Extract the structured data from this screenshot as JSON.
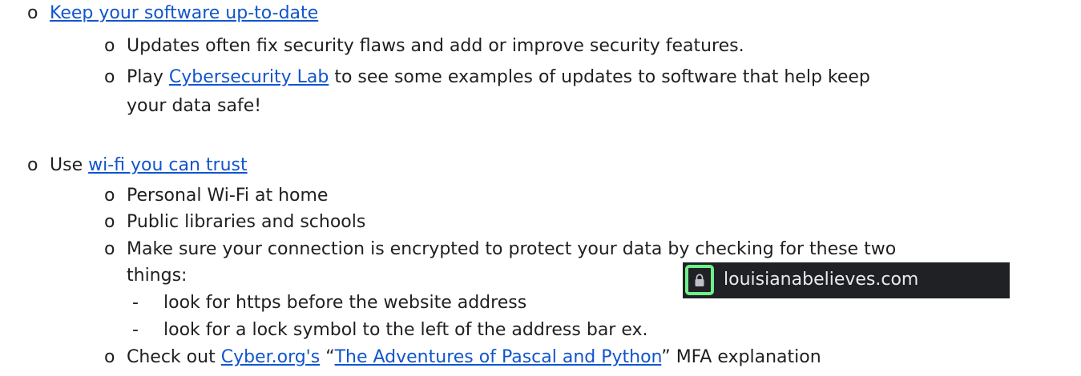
{
  "bullet_o": "o",
  "bullet_dash": "-",
  "section1": {
    "link": "Keep your software up-to-date",
    "items": [
      {
        "text": "Updates often fix security flaws and add or improve security features."
      },
      {
        "prefix": "Play ",
        "link": "Cybersecurity Lab",
        "suffix": " to see some examples of updates to software that help keep",
        "line2": "your data safe!"
      }
    ]
  },
  "section2": {
    "prefix": "Use ",
    "link": "wi-fi you can trust",
    "items": [
      "Personal Wi-Fi at home",
      "Public libraries and schools"
    ],
    "encrypt": {
      "line1": "Make sure your connection is encrypted to protect your data by checking for these two",
      "line2": "things:",
      "subitems": [
        "look for https before the website address",
        "look for a lock symbol to the left of the address bar ex."
      ]
    },
    "check": {
      "prefix": "Check out ",
      "link1": "Cyber.org's",
      "mid_open": " “",
      "link2": "The Adventures of Pascal and Python",
      "suffix": "” MFA explanation"
    }
  },
  "address_bar": {
    "url": "louisianabelieves.com",
    "icon": "lock-icon",
    "highlight_color": "#6ef08a",
    "bar_color": "#202124"
  }
}
